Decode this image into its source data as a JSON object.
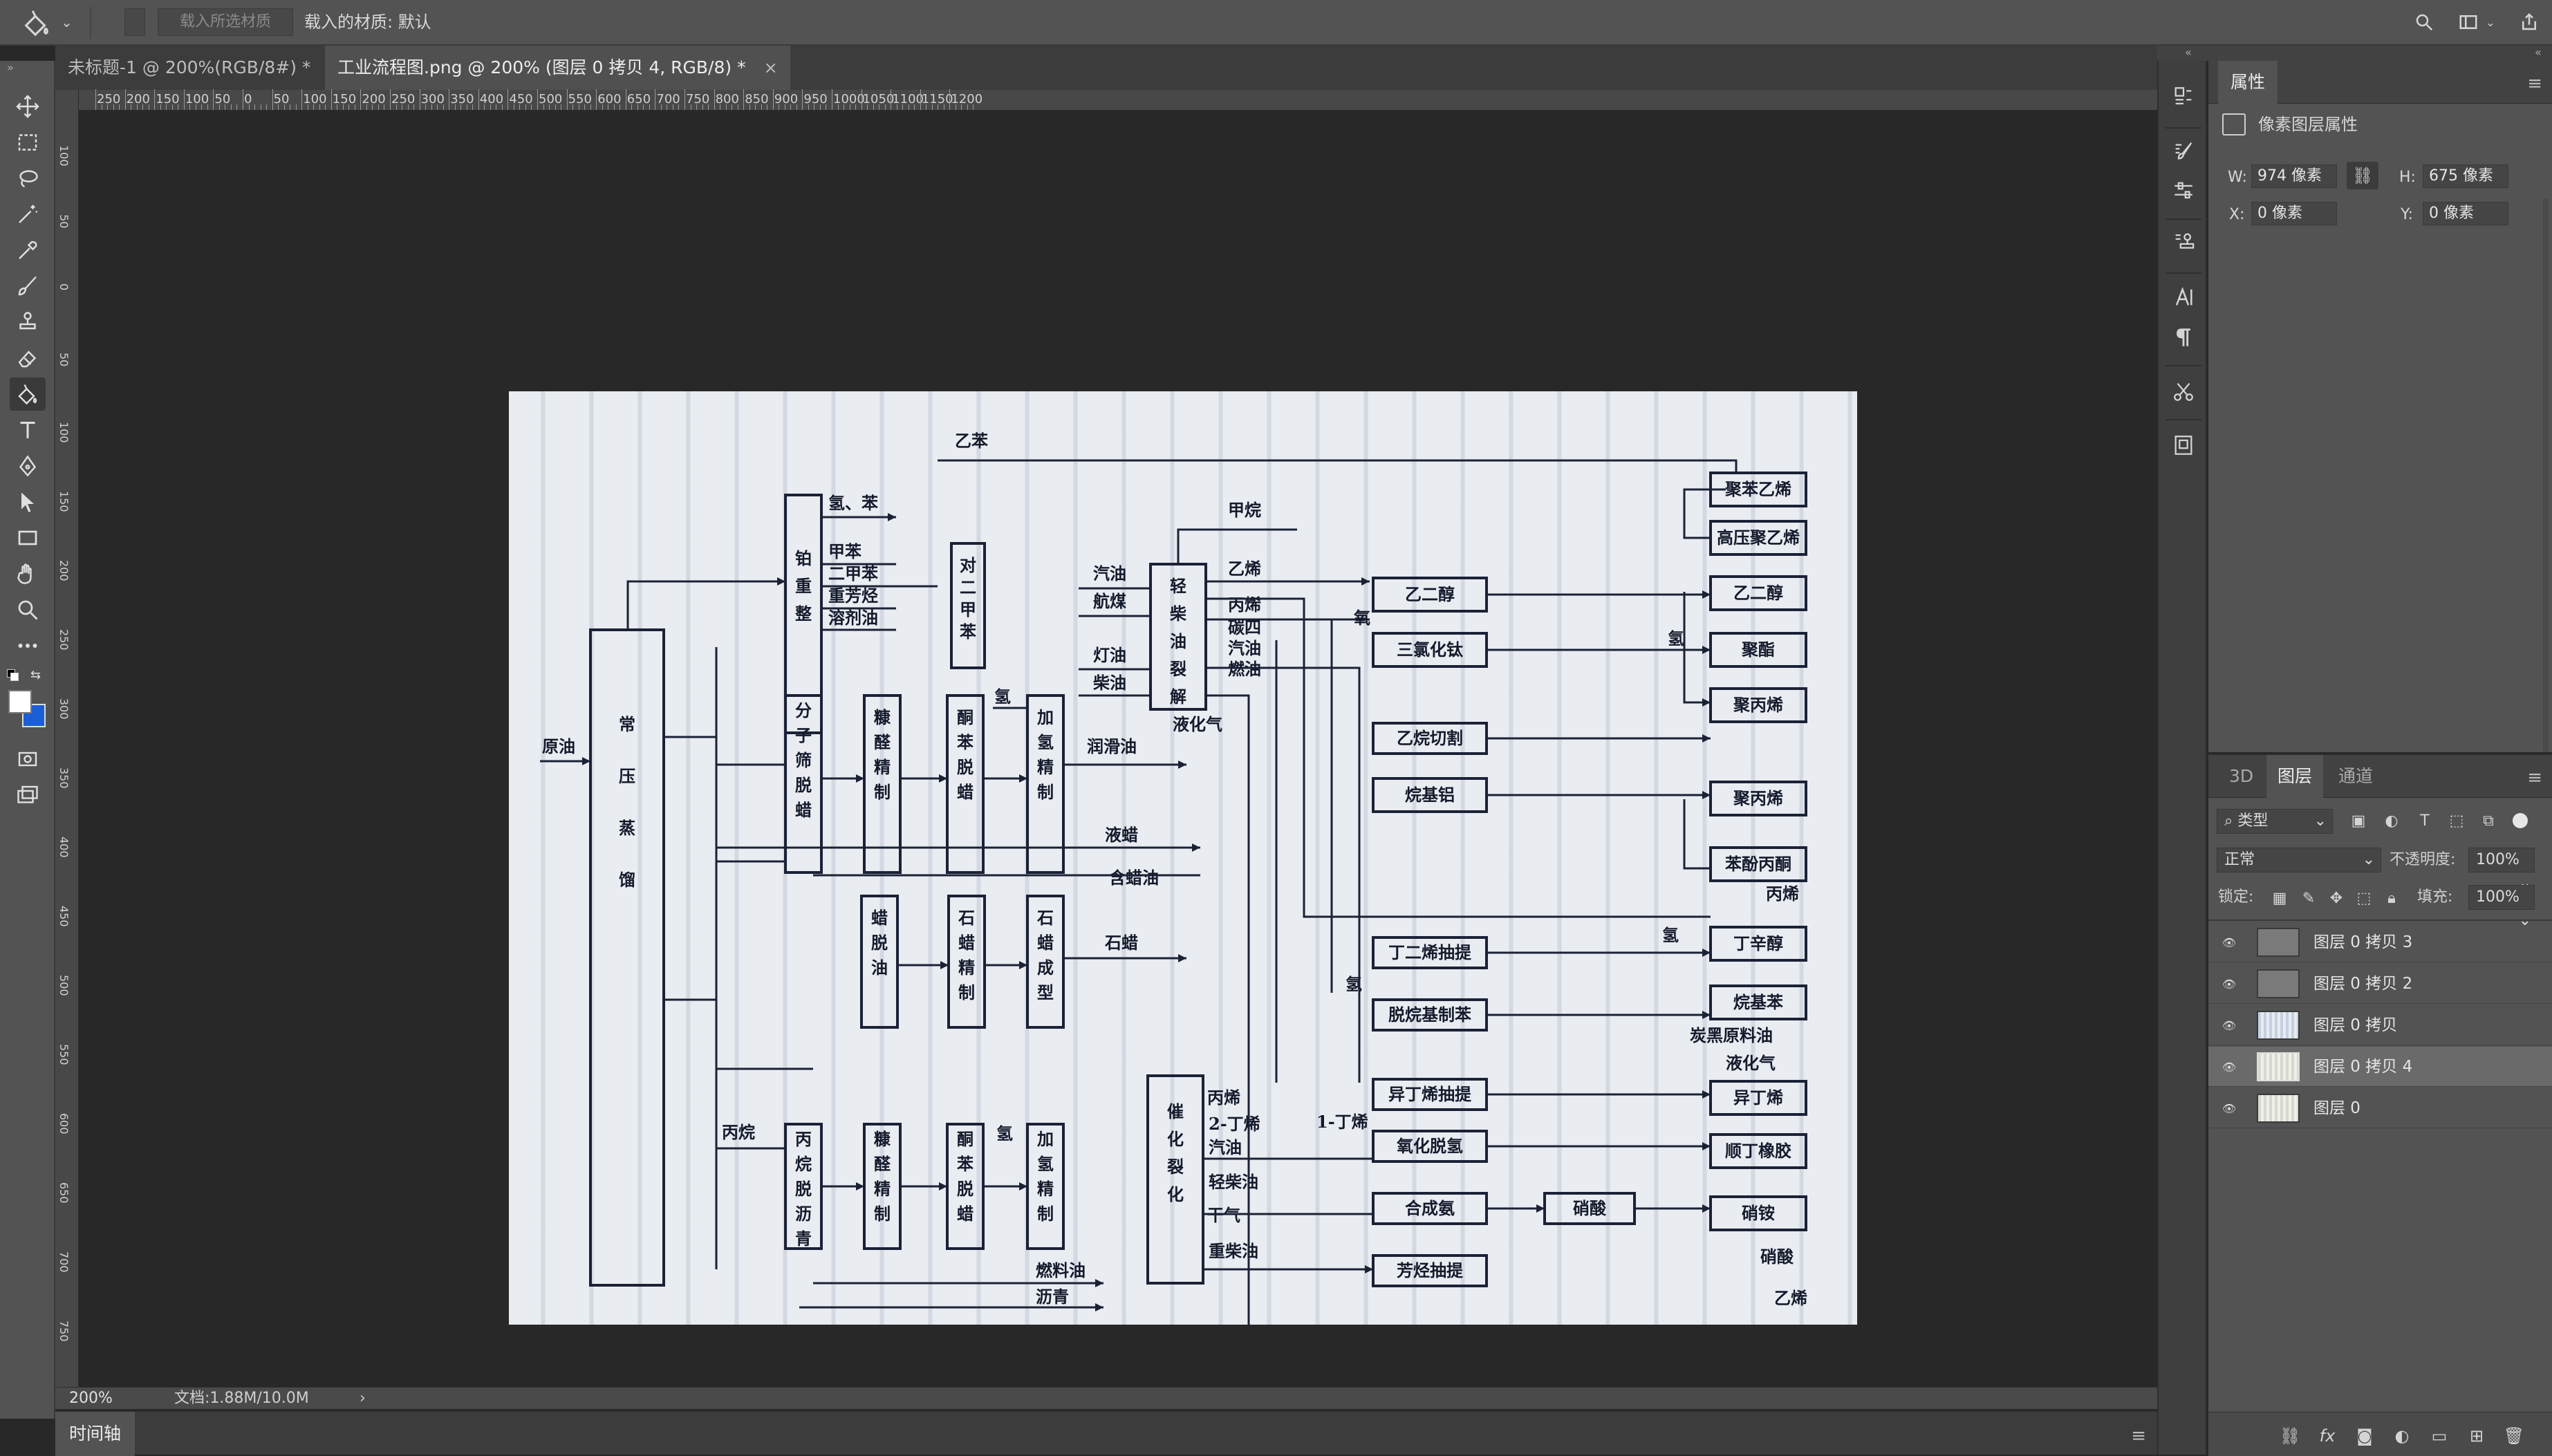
{
  "option_bar": {
    "material_placeholder": "载入所选材质",
    "material_label": "载入的材质: 默认"
  },
  "doc_tabs": [
    {
      "label": "未标题-1 @ 200%(RGB/8#) *",
      "active": false
    },
    {
      "label": "工业流程图.png @ 200% (图层 0 拷贝 4, RGB/8) *",
      "active": true
    }
  ],
  "ruler": {
    "top_labels": [
      "250",
      "200",
      "150",
      "100",
      "50",
      "0",
      "50",
      "100",
      "150",
      "200",
      "250",
      "300",
      "350",
      "400",
      "450",
      "500",
      "550",
      "600",
      "650",
      "700",
      "750",
      "800",
      "850",
      "900",
      "950",
      "1000",
      "1050",
      "1100",
      "1150",
      "1200"
    ],
    "left_labels": [
      "100",
      "50",
      "0",
      "50",
      "100",
      "150",
      "200",
      "250",
      "300",
      "350",
      "400",
      "450",
      "500",
      "550",
      "600",
      "650",
      "700",
      "750"
    ]
  },
  "status": {
    "zoom": "200%",
    "doc_info": "文档:1.88M/10.0M",
    "arrow": "›"
  },
  "timeline": {
    "label": "时间轴"
  },
  "properties": {
    "tab": "属性",
    "subtitle": "像素图层属性",
    "w_label": "W:",
    "w_value": "974 像素",
    "h_label": "H:",
    "h_value": "675 像素",
    "x_label": "X:",
    "x_value": "0 像素",
    "y_label": "Y:",
    "y_value": "0 像素"
  },
  "layers_panel": {
    "tabs": [
      {
        "label": "3D",
        "active": false
      },
      {
        "label": "图层",
        "active": true
      },
      {
        "label": "通道",
        "active": false
      }
    ],
    "filter_kind": "类型",
    "blend_mode": "正常",
    "opacity_label": "不透明度:",
    "opacity_value": "100%",
    "lock_label": "锁定:",
    "fill_label": "填充:",
    "fill_value": "100%",
    "layers": [
      {
        "name": "图层 0 拷贝 3",
        "selected": false
      },
      {
        "name": "图层 0 拷贝 2",
        "selected": false
      },
      {
        "name": "图层 0 拷贝",
        "selected": false
      },
      {
        "name": "图层 0 拷贝 4",
        "selected": true
      },
      {
        "name": "图层 0",
        "selected": false
      }
    ]
  },
  "flowchart": {
    "crude": "原油",
    "atm": "常压蒸馏",
    "reforming": "铂重整",
    "pxylene": "对二甲苯",
    "mol_sieve": "分子筛脱蜡",
    "furfural1": "糠醛精制",
    "ketone1": "酮苯脱蜡",
    "hydro1": "加氢精制",
    "steam_crack": "轻柴油裂解",
    "wax_deoil": "蜡脱油",
    "wax_refine": "石蜡精制",
    "wax_form": "石蜡成型",
    "propane_deasph": "丙烷脱沥青",
    "furfural2": "糠醛精制",
    "ketone2": "酮苯脱蜡",
    "hydro2": "加氢精制",
    "cat_crack": "催化裂化",
    "l_h2_benzene": "氢、苯",
    "l_toluene": "甲苯",
    "l_xylene": "二甲苯",
    "l_heavy_arom": "重芳烃",
    "l_solvent": "溶剂油",
    "l_ethylbenzene": "乙苯",
    "l_gasoline": "汽油",
    "l_jet": "航煤",
    "l_kerosene": "灯油",
    "l_diesel": "柴油",
    "l_lpg": "液化气",
    "l_lube": "润滑油",
    "l_liquid_wax": "液蜡",
    "l_wax_oil": "含蜡油",
    "l_paraffin": "石蜡",
    "l_h2": "氢",
    "l_propane": "丙烷",
    "l_fuel_oil": "燃料油",
    "l_asphalt": "沥青",
    "l_methane": "甲烷",
    "l_ethylene": "乙烯",
    "l_propylene": "丙烯",
    "l_c4": "碳四",
    "l_gasoline2": "汽油",
    "l_fuel2": "燃油",
    "l_oxygen": "氧",
    "l_propylene2": "丙烯",
    "l_h2b": "氢",
    "l_h2c": "氢",
    "l_propylene3": "丙烯",
    "l_butene2": "2-丁烯",
    "l_gasoline3": "汽油",
    "l_light_diesel": "轻柴油",
    "l_dry_gas": "干气",
    "l_heavy_diesel": "重柴油",
    "l_butene1": "1-丁烯",
    "l_ethylene2": "乙烯",
    "l_lpg2": "液化气",
    "l_nitric": "硝酸",
    "l_h2d": "氢",
    "l_aromatics_feed": "炭黑原料油",
    "p_glycol_proc": "乙二醇",
    "p_ticl3": "三氯化钛",
    "p_ethylbenzene_proc": "乙烷切割",
    "p_alkylalum": "烷基铝",
    "p_butadiene": "丁二烯抽提",
    "p_dealk": "脱烷基制苯",
    "p_isobutene": "异丁烯抽提",
    "p_oxydehydro": "氧化脱氢",
    "p_ammonia": "合成氨",
    "p_nitric": "硝酸",
    "p_aromatics": "芳烃抽提",
    "o_polystyrene": "聚苯乙烯",
    "o_hdpe": "高压聚乙烯",
    "o_glycol": "乙二醇",
    "o_polyester": "聚酯",
    "o_pp": "聚丙烯",
    "o_pp2": "聚丙烯",
    "o_phenol": "苯酚丙酮",
    "o_octanol": "丁辛醇",
    "o_alkylbenzene": "烷基苯",
    "o_isobutene": "异丁烯",
    "o_rubber": "顺丁橡胶",
    "o_ammonium": "硝铵"
  }
}
